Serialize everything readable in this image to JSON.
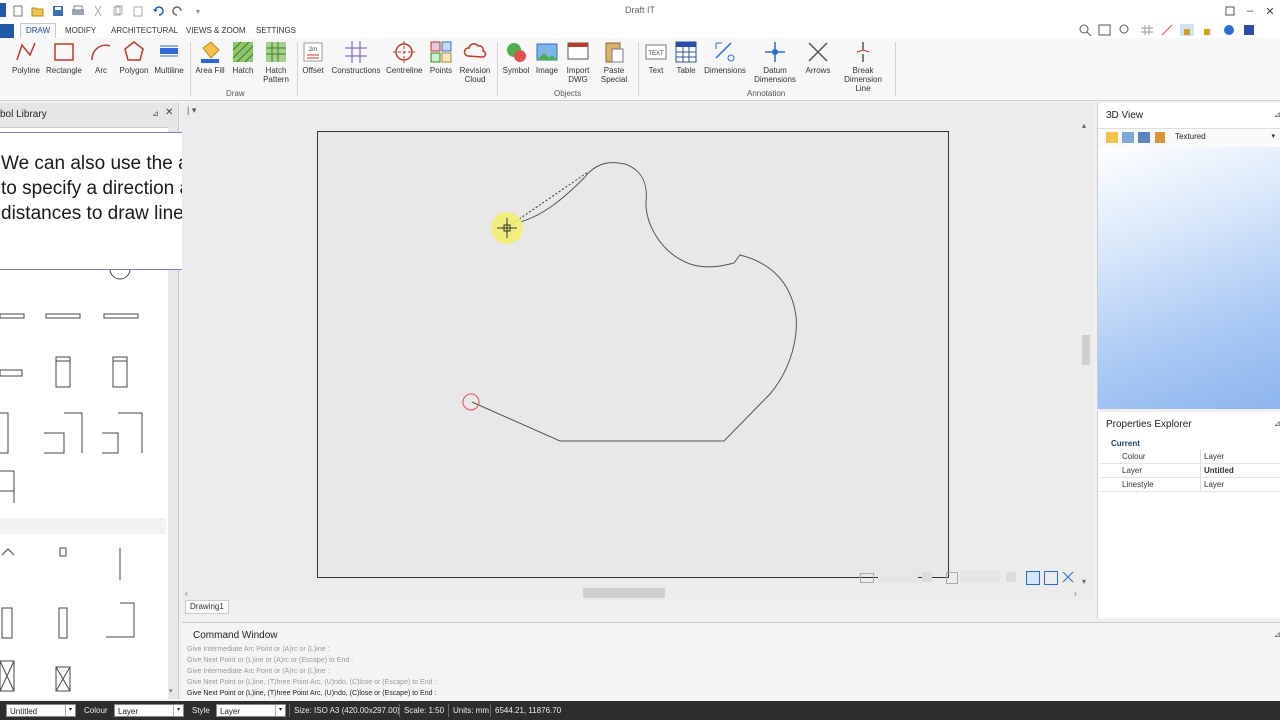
{
  "app": {
    "title": "Draft IT"
  },
  "ribbon": {
    "tabs": [
      "DRAW",
      "MODIFY",
      "ARCHITECTURAL",
      "VIEWS & ZOOM",
      "SETTINGS"
    ],
    "active_tab": "DRAW",
    "draw": {
      "group_label": "Draw",
      "polyline": "Polyline",
      "rectangle": "Rectangle",
      "arc": "Arc",
      "polygon": "Polygon",
      "multiline": "Multiline",
      "area_fill": "Area Fill",
      "hatch": "Hatch",
      "hatch_pattern_1": "Hatch",
      "hatch_pattern_2": "Pattern",
      "offset": "Offset",
      "constructions": "Constructions",
      "centreline": "Centreline",
      "points": "Points",
      "revision_cloud_1": "Revision",
      "revision_cloud_2": "Cloud"
    },
    "objects": {
      "group_label": "Objects",
      "symbol": "Symbol",
      "image": "Image",
      "import_dwg_1": "Import",
      "import_dwg_2": "DWG",
      "paste_special_1": "Paste",
      "paste_special_2": "Special"
    },
    "annotation": {
      "group_label": "Annotation",
      "text": "Text",
      "table": "Table",
      "dimensions": "Dimensions",
      "datum_dimensions_1": "Datum",
      "datum_dimensions_2": "Dimensions",
      "arrows": "Arrows",
      "break_dimension_line_1": "Break",
      "break_dimension_line_2": "Dimension Line"
    }
  },
  "symbol_library": {
    "title": "Symbol Library"
  },
  "callout": {
    "text": "We can also use the arrows keys to specify a direction and enter distances to draw lines like so."
  },
  "document": {
    "tab": "Drawing1"
  },
  "view3d": {
    "title": "3D View",
    "mode": "Textured"
  },
  "properties": {
    "title": "Properties Explorer",
    "section": "Current",
    "rows": [
      {
        "key": "Colour",
        "value": "Layer"
      },
      {
        "key": "Layer",
        "value": "Untitled"
      },
      {
        "key": "Linestyle",
        "value": "Layer"
      }
    ]
  },
  "command": {
    "title": "Command Window",
    "lines": [
      "Give Intermediate Arc Point or (A)rc or (L)ine :",
      "Give Next Point or (L)ine or (A)rc or (Escape) to End :",
      "Give Intermediate Arc Point or (A)rc or (L)ine :",
      "Give Next Point or (L)ine, (T)hree Point Arc, (U)ndo, (C)lose or (Escape) to End :",
      "Give Next Point or (L)ine, (T)hree Point Arc, (U)ndo, (C)lose or (Escape) to End :"
    ]
  },
  "status": {
    "layer": "Untitled",
    "colour_label": "Colour",
    "colour_value": "Layer",
    "style_label": "Style",
    "style_value": "Layer",
    "size": "Size: ISO A3 (420.00x297.00)",
    "scale": "Scale: 1:50",
    "units": "Units: mm",
    "coords": "6544.21, 11876.70"
  },
  "colors": {
    "accent": "#1e5aa8",
    "status_bg": "#2d2d30",
    "cursor_highlight": "#f3ee6a",
    "end_marker": "#e05050"
  }
}
